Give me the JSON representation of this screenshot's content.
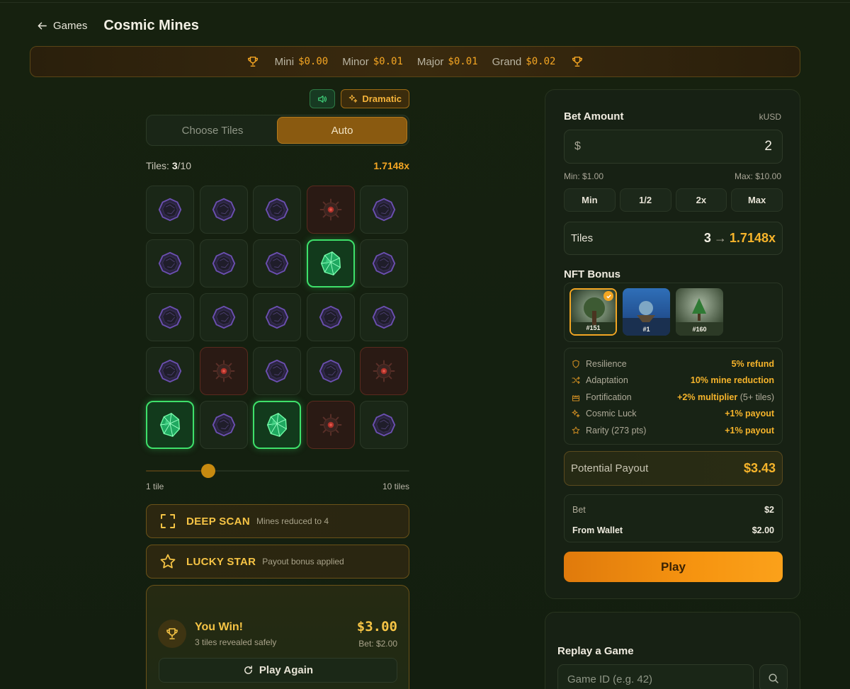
{
  "header": {
    "back_label": "Games",
    "title": "Cosmic Mines"
  },
  "jackpot": [
    {
      "label": "Mini",
      "value": "$0.00"
    },
    {
      "label": "Minor",
      "value": "$0.01"
    },
    {
      "label": "Major",
      "value": "$0.01"
    },
    {
      "label": "Grand",
      "value": "$0.02"
    }
  ],
  "controls": {
    "sound_icon": "speaker-icon",
    "dramatic_label": "Dramatic"
  },
  "mode_tabs": [
    {
      "label": "Choose Tiles",
      "active": false
    },
    {
      "label": "Auto",
      "active": true
    }
  ],
  "tiles_info": {
    "label": "Tiles:",
    "selected": "3",
    "total": "/10",
    "multiplier": "1.7148x"
  },
  "grid": [
    [
      "crystal",
      "crystal",
      "crystal",
      "mine",
      "crystal"
    ],
    [
      "crystal",
      "crystal",
      "crystal",
      "gem",
      "crystal"
    ],
    [
      "crystal",
      "crystal",
      "crystal",
      "crystal",
      "crystal"
    ],
    [
      "crystal",
      "mine",
      "crystal",
      "crystal",
      "mine"
    ],
    [
      "gem",
      "crystal",
      "gem",
      "mine",
      "crystal"
    ]
  ],
  "slider": {
    "min_label": "1 tile",
    "max_label": "10 tiles",
    "value": 3,
    "min": 1,
    "max": 10
  },
  "bonuses": [
    {
      "name": "DEEP SCAN",
      "desc": "Mines reduced to 4",
      "icon": "scan-frame-icon"
    },
    {
      "name": "LUCKY STAR",
      "desc": "Payout bonus applied",
      "icon": "star-icon"
    }
  ],
  "win": {
    "title": "You Win!",
    "subtitle": "3 tiles revealed safely",
    "amount": "$3.00",
    "bet": "Bet: $2.00",
    "play_again": "Play Again"
  },
  "bet_panel": {
    "title": "Bet Amount",
    "currency": "kUSD",
    "symbol": "$",
    "amount": "2",
    "min": "Min: $1.00",
    "max": "Max: $10.00",
    "quick": [
      "Min",
      "1/2",
      "2x",
      "Max"
    ],
    "tiles_label": "Tiles",
    "tiles_value": "3",
    "tiles_arrow": "→",
    "tiles_mult": "1.7148x",
    "nft_title": "NFT Bonus",
    "nfts": [
      {
        "id": "#151",
        "selected": true
      },
      {
        "id": "#1",
        "selected": false
      },
      {
        "id": "#160",
        "selected": false
      }
    ],
    "traits": [
      {
        "name": "Resilience",
        "value": "5% refund",
        "extra": "",
        "icon": "shield-icon"
      },
      {
        "name": "Adaptation",
        "value": "10% mine reduction",
        "extra": "",
        "icon": "shuffle-icon"
      },
      {
        "name": "Fortification",
        "value": "+2% multiplier",
        "extra": "(5+ tiles)",
        "icon": "castle-icon"
      },
      {
        "name": "Cosmic Luck",
        "value": "+1% payout",
        "extra": "",
        "icon": "sparkles-icon"
      },
      {
        "name": "Rarity (273 pts)",
        "value": "+1% payout",
        "extra": "",
        "icon": "star-icon"
      }
    ],
    "payout_label": "Potential Payout",
    "payout_value": "$3.43",
    "summary": [
      {
        "key": "Bet",
        "value": "$2"
      },
      {
        "key": "From Wallet",
        "value": "$2.00"
      }
    ],
    "play_label": "Play"
  },
  "replay": {
    "title": "Replay a Game",
    "placeholder": "Game ID (e.g. 42)"
  },
  "colors": {
    "accent": "#f5a623",
    "gem": "#3ee06a",
    "bg": "#15200f"
  }
}
